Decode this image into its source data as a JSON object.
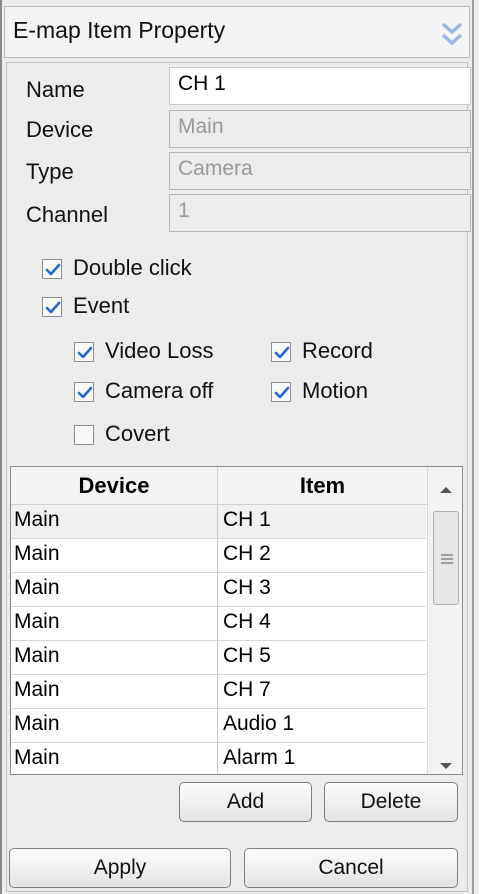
{
  "window": {
    "title": "E-map Item Property"
  },
  "icons": {
    "collapse": "double-chevron-down-icon",
    "scroll_up": "arrow-up-icon",
    "scroll_down": "arrow-down-icon",
    "grip": "scroll-grip-icon",
    "check": "check-icon"
  },
  "colors": {
    "chevron": "#9db7e6",
    "check": "#2a64d0"
  },
  "properties": {
    "name_label": "Name",
    "name_value": "CH 1",
    "device_label": "Device",
    "device_value": "Main",
    "type_label": "Type",
    "type_value": "Camera",
    "channel_label": "Channel",
    "channel_value": "1"
  },
  "options": {
    "double_click": {
      "label": "Double click",
      "checked": true
    },
    "event": {
      "label": "Event",
      "checked": true
    },
    "video_loss": {
      "label": "Video Loss",
      "checked": true
    },
    "record": {
      "label": "Record",
      "checked": true
    },
    "camera_off": {
      "label": "Camera off",
      "checked": true
    },
    "motion": {
      "label": "Motion",
      "checked": true
    },
    "covert": {
      "label": "Covert",
      "checked": false
    }
  },
  "table": {
    "columns": [
      "Device",
      "Item"
    ],
    "rows": [
      {
        "device": "Main",
        "item": "CH 1"
      },
      {
        "device": "Main",
        "item": "CH 2"
      },
      {
        "device": "Main",
        "item": "CH 3"
      },
      {
        "device": "Main",
        "item": "CH 4"
      },
      {
        "device": "Main",
        "item": "CH 5"
      },
      {
        "device": "Main",
        "item": "CH 7"
      },
      {
        "device": "Main",
        "item": "Audio 1"
      },
      {
        "device": "Main",
        "item": "Alarm 1"
      }
    ]
  },
  "buttons": {
    "add": "Add",
    "delete": "Delete",
    "apply": "Apply",
    "cancel": "Cancel"
  }
}
